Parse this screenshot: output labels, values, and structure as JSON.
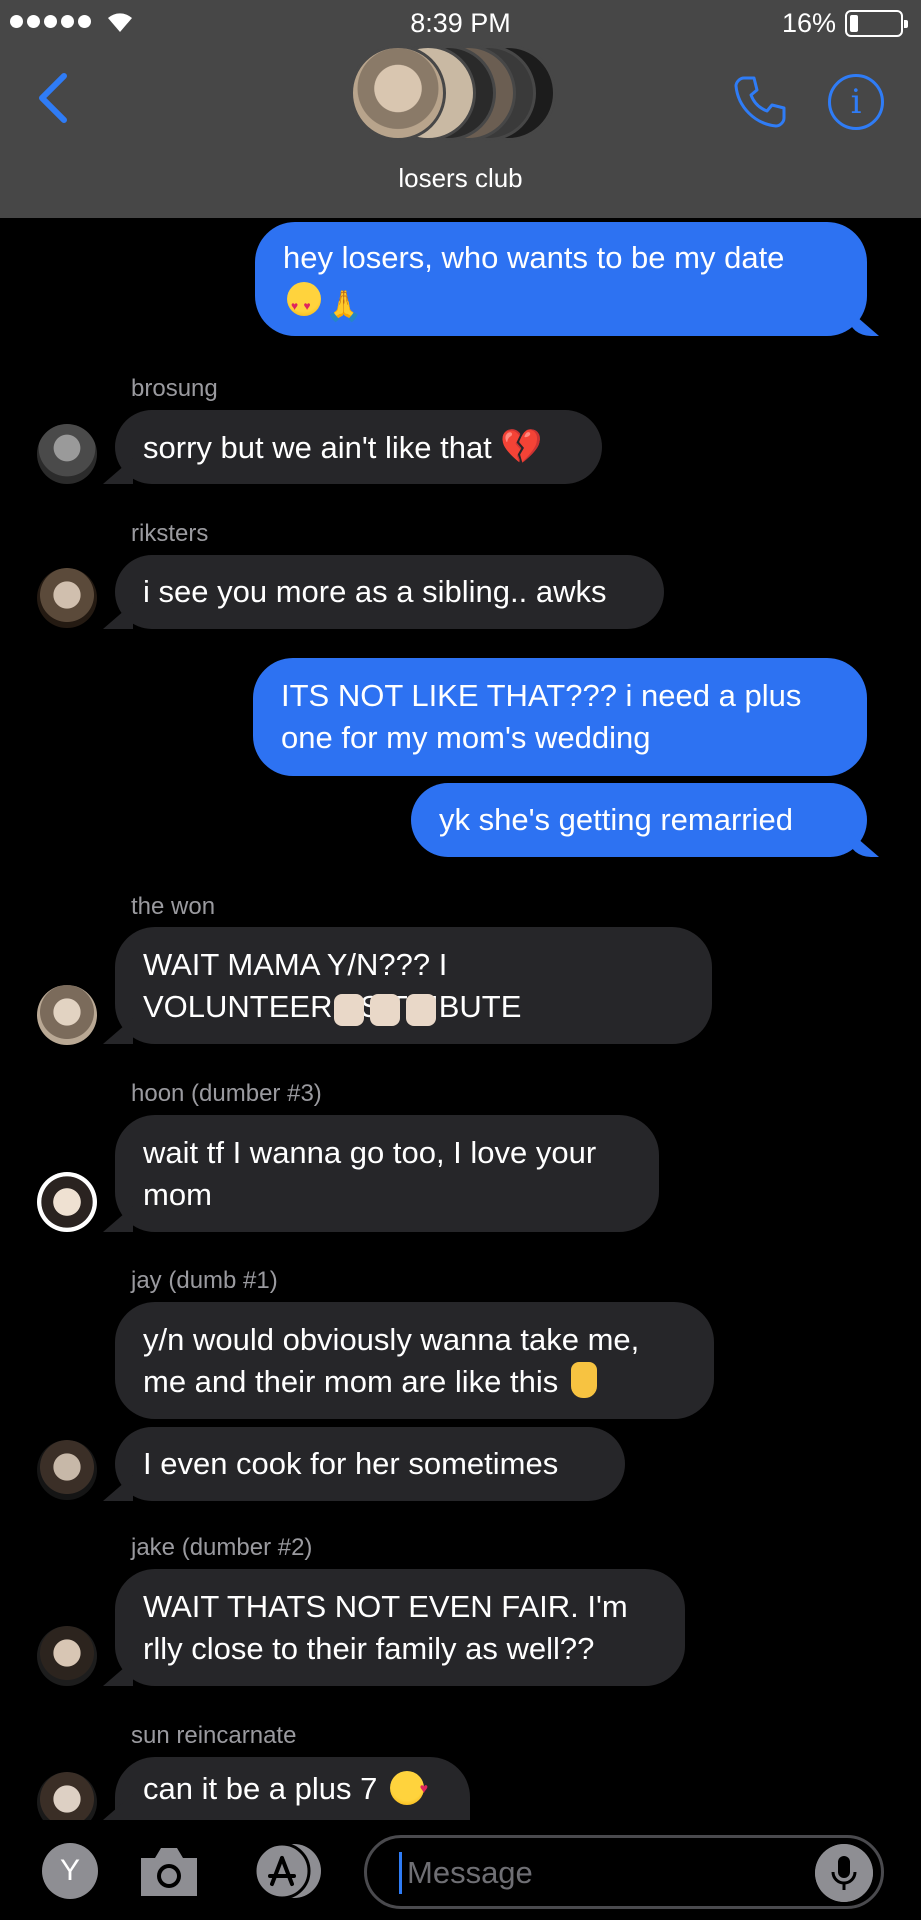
{
  "status_bar": {
    "time": "8:39 PM",
    "battery_percent": "16%",
    "battery_level": 0.16
  },
  "header": {
    "group_name": "losers club",
    "accent_color": "#2f7cf6",
    "info_label": "i"
  },
  "messages": [
    {
      "dir": "out",
      "text": "hey losers, who wants to be my date",
      "emoji": [
        "heart-eyes",
        "pray"
      ]
    },
    {
      "dir": "in",
      "sender": "brosung",
      "text": "sorry but we ain't like that",
      "emoji": [
        "broken-heart"
      ]
    },
    {
      "dir": "in",
      "sender": "riksters",
      "text": "i see you more as a sibling.. awks"
    },
    {
      "dir": "out",
      "text": "ITS NOT LIKE THAT??? i need a plus one for my mom's wedding"
    },
    {
      "dir": "out",
      "text": "yk she's getting remarried"
    },
    {
      "dir": "in",
      "sender": "the won",
      "text": "WAIT MAMA Y/N??? I VOLUNTEER AS TRIBUTE",
      "emoji": [
        "raising-hand",
        "raising-hand",
        "raising-hand"
      ]
    },
    {
      "dir": "in",
      "sender": "hoon (dumber #3)",
      "text": "wait tf I wanna go too, I love your mom"
    },
    {
      "dir": "in",
      "sender": "jay (dumb #1)",
      "text": "y/n would obviously wanna take me, me and their mom are like this",
      "emoji": [
        "crossed-fingers"
      ]
    },
    {
      "dir": "in",
      "text": "I even cook for her sometimes"
    },
    {
      "dir": "in",
      "sender": "jake (dumber #2)",
      "text": "WAIT THATS NOT EVEN FAIR. I'm rlly close to their family as well??"
    },
    {
      "dir": "in",
      "sender": "sun reincarnate",
      "text": "can it be a plus 7",
      "emoji": [
        "smiling-hearts"
      ]
    }
  ],
  "composer": {
    "app_letter": "Y",
    "placeholder": "Message"
  },
  "colors": {
    "outgoing_bubble": "#2d72f2",
    "incoming_bubble": "#262629",
    "header_bg": "#474747"
  }
}
